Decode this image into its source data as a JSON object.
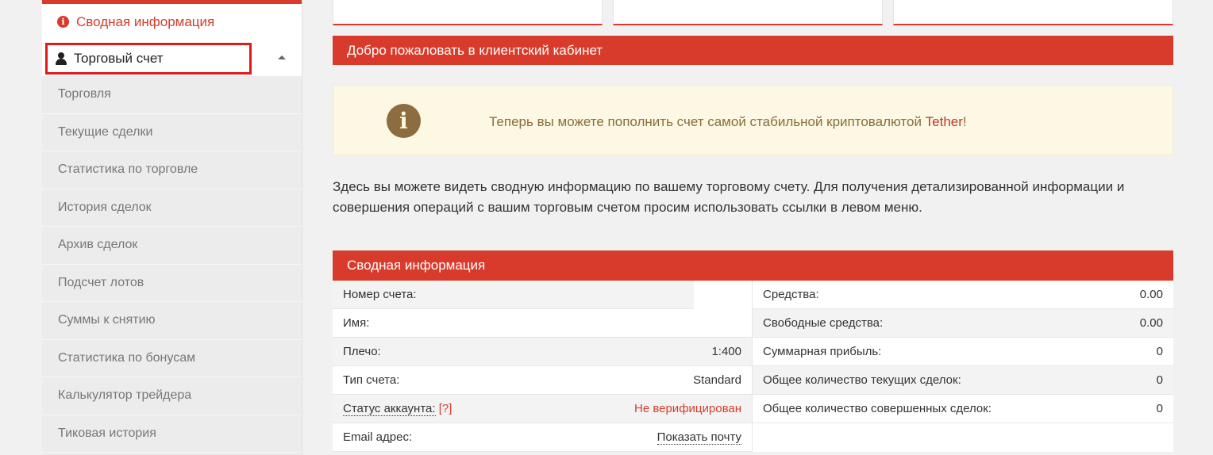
{
  "sidebar": {
    "summary_label": "Сводная информация",
    "trade_account_label": "Торговый счет",
    "items": [
      {
        "label": "Торговля"
      },
      {
        "label": "Текущие сделки"
      },
      {
        "label": "Статистика по торговле"
      },
      {
        "label": "История сделок"
      },
      {
        "label": "Архив сделок"
      },
      {
        "label": "Подсчет лотов"
      },
      {
        "label": "Суммы к снятию"
      },
      {
        "label": "Статистика по бонусам"
      },
      {
        "label": "Калькулятор трейдера"
      },
      {
        "label": "Тиковая история"
      }
    ]
  },
  "welcome": {
    "title": "Добро пожаловать в клиентский кабинет"
  },
  "notice": {
    "icon": "info-icon",
    "text_before": "Теперь вы можете пополнить счет самой стабильной криптовалютой ",
    "link": "Tether",
    "text_after": "!"
  },
  "intro": {
    "line1": "Здесь вы можете видеть сводную информацию по вашему торговому счету. Для получения детализированной информации и",
    "line2": "совершения операций с вашим торговым счетом просим использовать ссылки в левом меню."
  },
  "summary": {
    "title": "Сводная информация",
    "left": [
      {
        "label": "Номер счета:",
        "value": ""
      },
      {
        "label": "Имя:",
        "value": ""
      },
      {
        "label": "Плечо:",
        "value": "1:400"
      },
      {
        "label": "Тип счета:",
        "value": "Standard"
      },
      {
        "label": "Статус аккаунта:",
        "help": "[?]",
        "value": "Не верифицирован"
      },
      {
        "label": "Email адрес:",
        "value": "Показать почту"
      }
    ],
    "right": [
      {
        "label": "Средства:",
        "value": "0.00"
      },
      {
        "label": "Свободные средства:",
        "value": "0.00"
      },
      {
        "label": "Суммарная прибыль:",
        "value": "0"
      },
      {
        "label": "Общее количество текущих сделок:",
        "value": "0"
      },
      {
        "label": "Общее количество совершенных сделок:",
        "value": "0"
      }
    ]
  },
  "colors": {
    "accent": "#d83b2b",
    "notice_bg": "#fcf8e3",
    "notice_text": "#8a6d3b"
  }
}
